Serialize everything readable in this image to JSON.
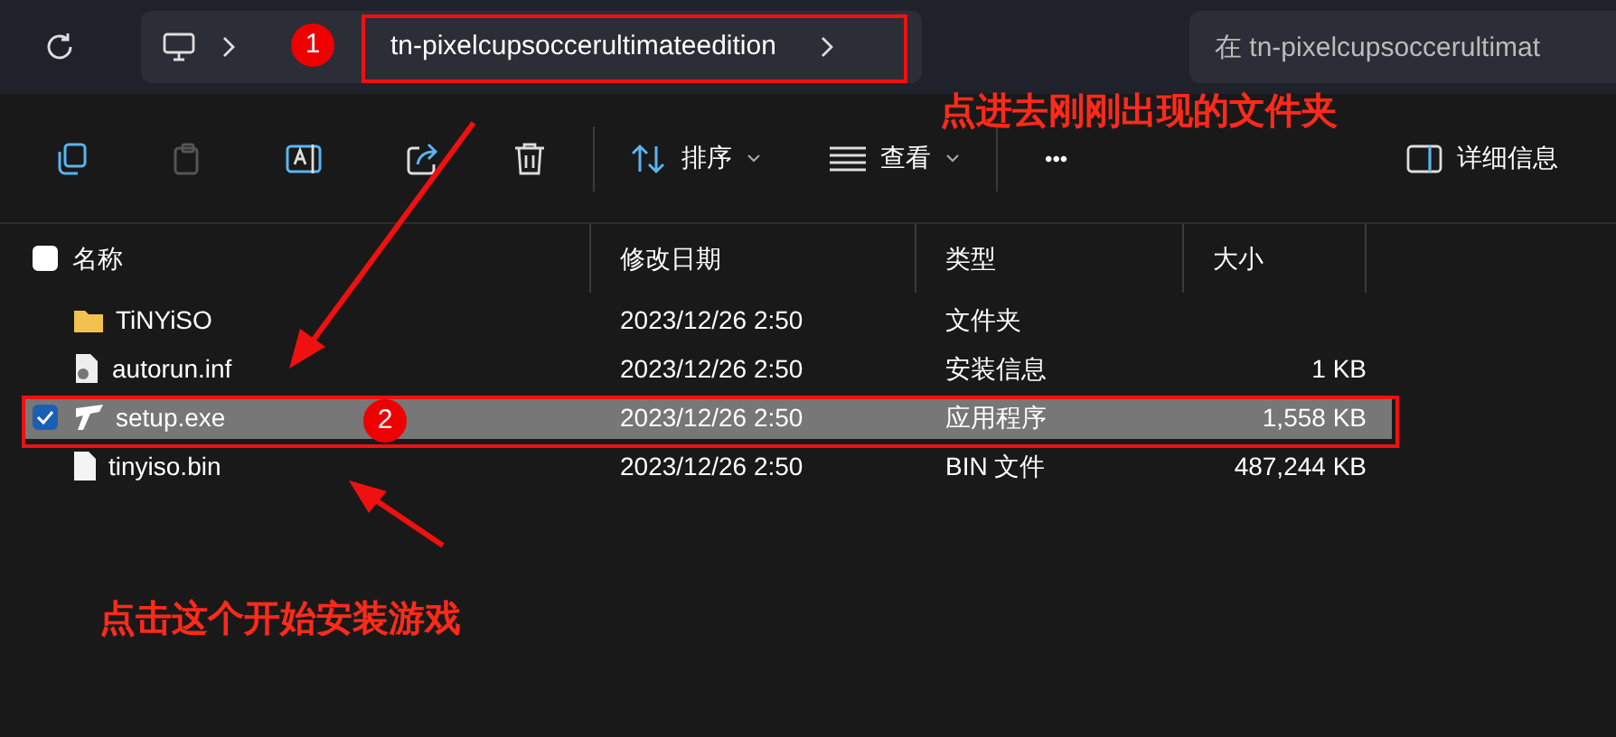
{
  "address_bar": {
    "path": [
      {
        "label": "tn-pixelcupsoccerultimateedition"
      }
    ]
  },
  "search": {
    "placeholder": "在 tn-pixelcupsoccerultimat"
  },
  "toolbar": {
    "sort": "排序",
    "view": "查看",
    "more": "•••",
    "details": "详细信息"
  },
  "table": {
    "select_all": {
      "checked": false
    },
    "columns": [
      "名称",
      "修改日期",
      "类型",
      "大小"
    ],
    "rows": [
      {
        "kind": "folder",
        "name": "TiNYiSO",
        "date": "2023/12/26 2:50",
        "type": "文件夹",
        "selected": false
      },
      {
        "kind": "settings",
        "name": "autorun.inf",
        "date": "2023/12/26 2:50",
        "type": "安装信息",
        "size": "1 KB",
        "selected": false
      },
      {
        "kind": "app",
        "name": "setup.exe",
        "date": "2023/12/26 2:50",
        "type": "应用程序",
        "size": "1,558 KB",
        "selected": true
      },
      {
        "kind": "file",
        "name": "tinyiso.bin",
        "date": "2023/12/26 2:50",
        "type": "BIN 文件",
        "size": "487,244 KB",
        "selected": false
      }
    ]
  },
  "annotations": [
    {
      "number": "1",
      "text": "点进去刚刚出现的文件夹"
    },
    {
      "number": "2",
      "text": "点击这个开始安装游戏"
    }
  ]
}
